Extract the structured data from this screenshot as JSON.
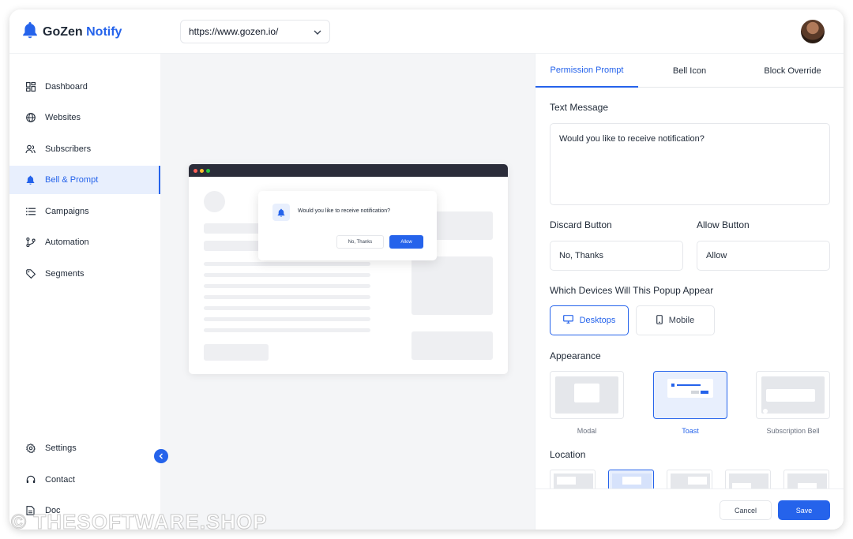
{
  "brand": {
    "name": "GoZen",
    "product": "Notify",
    "accent": "#2563eb"
  },
  "header": {
    "url_value": "https://www.gozen.io/"
  },
  "sidebar": {
    "items": [
      {
        "label": "Dashboard",
        "icon": "dashboard-icon"
      },
      {
        "label": "Websites",
        "icon": "globe-icon"
      },
      {
        "label": "Subscribers",
        "icon": "users-icon"
      },
      {
        "label": "Bell & Prompt",
        "icon": "bell-icon",
        "active": true
      },
      {
        "label": "Campaigns",
        "icon": "list-icon"
      },
      {
        "label": "Automation",
        "icon": "branch-icon"
      },
      {
        "label": "Segments",
        "icon": "tag-icon"
      }
    ],
    "bottom_items": [
      {
        "label": "Settings",
        "icon": "gear-icon"
      },
      {
        "label": "Contact",
        "icon": "headset-icon"
      },
      {
        "label": "Doc",
        "icon": "document-icon"
      }
    ]
  },
  "preview": {
    "message": "Would you like to receive notification?",
    "discard": "No, Thanks",
    "allow": "Allow"
  },
  "panel": {
    "tabs": [
      "Permission Prompt",
      "Bell Icon",
      "Block Override"
    ],
    "text_message_label": "Text Message",
    "text_message_value": "Would you like to receive notification?",
    "discard_label": "Discard Button",
    "discard_value": "No, Thanks",
    "allow_label": "Allow Button",
    "allow_value": "Allow",
    "devices_label": "Which Devices Will This Popup Appear",
    "devices": [
      "Desktops",
      "Mobile"
    ],
    "appearance_label": "Appearance",
    "appearance_options": [
      "Modal",
      "Toast",
      "Subscription Bell"
    ],
    "location_label": "Location",
    "cancel": "Cancel",
    "save": "Save"
  },
  "watermark": "© THESOFTWARE.SHOP"
}
